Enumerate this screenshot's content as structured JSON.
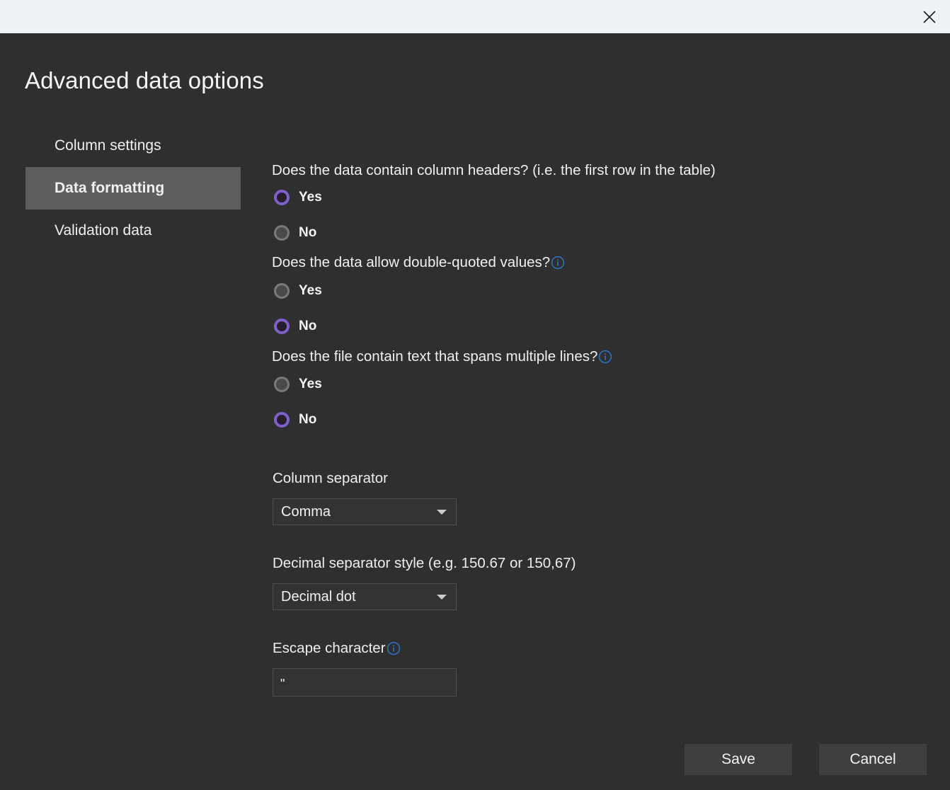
{
  "titlebar": {
    "close_icon": "close-icon"
  },
  "dialog": {
    "title": "Advanced data options"
  },
  "sidebar": {
    "items": [
      {
        "label": "Column settings",
        "selected": false
      },
      {
        "label": "Data formatting",
        "selected": true
      },
      {
        "label": "Validation data",
        "selected": false
      }
    ]
  },
  "main": {
    "questions": [
      {
        "text": "Does the data contain column headers? (i.e. the first row in the table)",
        "has_info_icon": false,
        "options": [
          {
            "label": "Yes",
            "selected": true
          },
          {
            "label": "No",
            "selected": false
          }
        ]
      },
      {
        "text": "Does the data allow double-quoted values?",
        "has_info_icon": true,
        "options": [
          {
            "label": "Yes",
            "selected": false
          },
          {
            "label": "No",
            "selected": true
          }
        ]
      },
      {
        "text": "Does the file contain text that spans multiple lines?",
        "has_info_icon": true,
        "options": [
          {
            "label": "Yes",
            "selected": false
          },
          {
            "label": "No",
            "selected": true
          }
        ]
      }
    ],
    "column_separator": {
      "label": "Column separator",
      "value": "Comma"
    },
    "decimal_separator": {
      "label": "Decimal separator style (e.g. 150.67 or 150,67)",
      "value": "Decimal dot"
    },
    "escape_character": {
      "label": "Escape character",
      "value": "\"",
      "placeholder": ""
    }
  },
  "footer": {
    "save_label": "Save",
    "cancel_label": "Cancel"
  },
  "colors": {
    "page_background": "#2f2f2f",
    "titlebar_background": "#eef1f6",
    "selected_nav_background": "#5e5e5e",
    "radio_selected": "#8160cc",
    "radio_unselected": "#7a7a7a",
    "info_icon": "#2e74c8",
    "button_background": "#3f3f3f"
  }
}
